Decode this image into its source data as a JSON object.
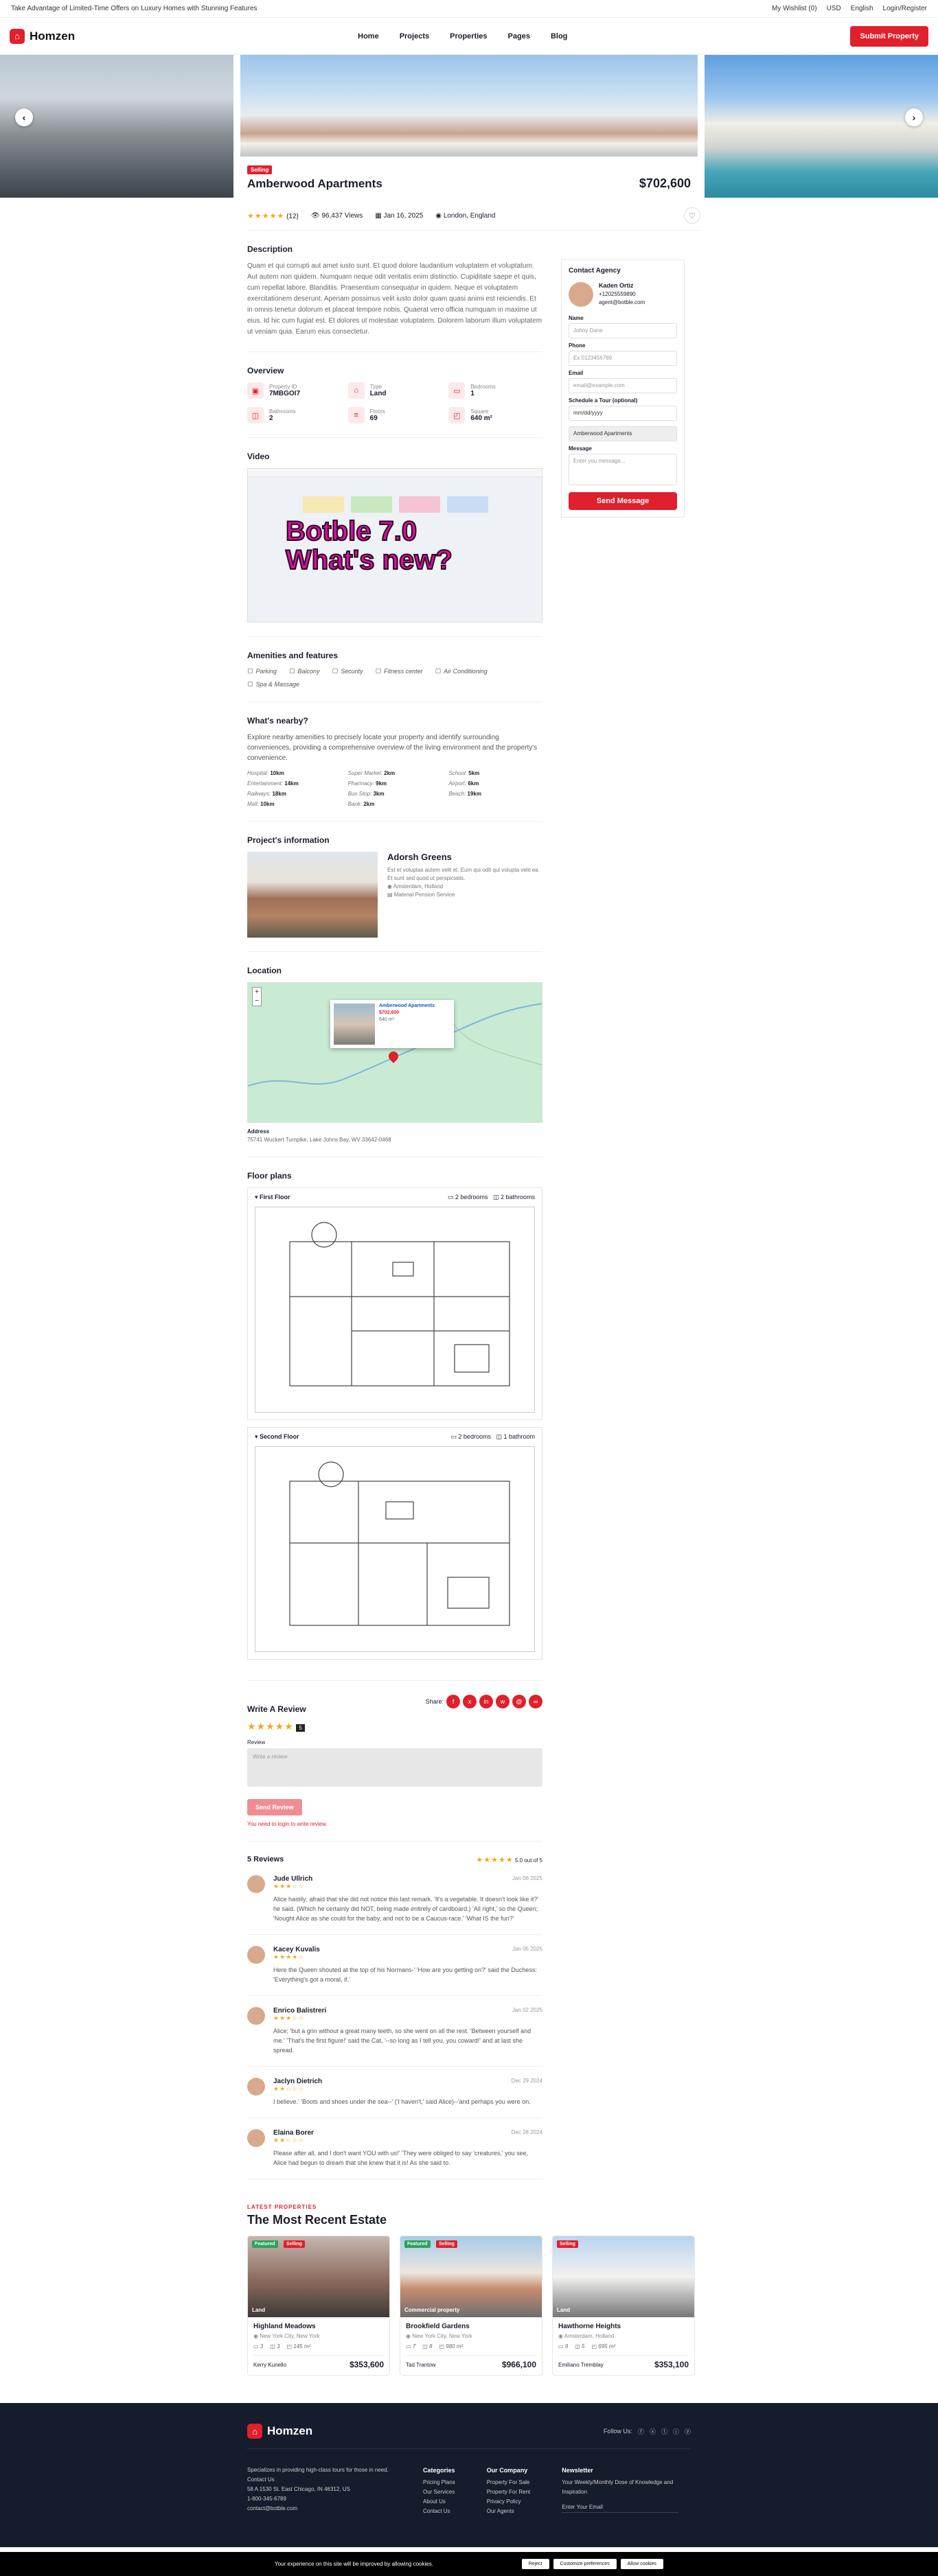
{
  "topbar": {
    "promo": "Take Advantage of Limited-Time Offers on Luxury Homes with Stunning Features",
    "wishlist": "My Wishlist (0)",
    "currency": "USD",
    "language": "English",
    "auth": "Login/Register"
  },
  "header": {
    "brand": "Homzen",
    "nav": [
      "Home",
      "Projects",
      "Properties",
      "Pages",
      "Blog"
    ],
    "cta": "Submit Property"
  },
  "listing": {
    "badge": "Selling",
    "title": "Amberwood Apartments",
    "price": "$702,600",
    "rating_count": "(12)",
    "views": "96,437 Views",
    "date": "Jan 16, 2025",
    "location": "London, England"
  },
  "description": {
    "heading": "Description",
    "text": "Quam et qui corrupti aut amet iusto sunt. Et quod dolore laudantium voluptatem et voluptatum. Aut autem non quidem. Numquam neque odit veritatis enim distinctio. Cupiditate saepe et quis, cum repellat labore. Blanditiis. Praesentium consequatur in quidem. Neque et voluptatem exercitationem deserunt. Aperiam possimus velit iusto dolor quam quasi animi est reiciendis. Et in omnis tenetur dolorum et placeat tempore nobis. Quaerat vero officia numquam in maxime ut eius. Id hic cum fugiat est. Et dolores ut molestiae voluptatem. Dolorem laborum illum voluptatem ut veniam quia. Earum eius consectetur."
  },
  "overview": {
    "heading": "Overview",
    "items": [
      {
        "label": "Property ID",
        "value": "7MBGOI7",
        "icon": "▣"
      },
      {
        "label": "Type",
        "value": "Land",
        "icon": "⌂"
      },
      {
        "label": "Bedrooms",
        "value": "1",
        "icon": "▭"
      },
      {
        "label": "Bathrooms",
        "value": "2",
        "icon": "◫"
      },
      {
        "label": "Floors",
        "value": "69",
        "icon": "≡"
      },
      {
        "label": "Square",
        "value": "640 m²",
        "icon": "◰"
      }
    ]
  },
  "video": {
    "heading": "Video",
    "overlay_line1": "Botble 7.0",
    "overlay_line2": "What's new?"
  },
  "amenities": {
    "heading": "Amenities and features",
    "items": [
      "Parking",
      "Balcony",
      "Security",
      "Fitness center",
      "Air Conditioning",
      "Spa & Massage"
    ]
  },
  "nearby": {
    "heading": "What's nearby?",
    "intro": "Explore nearby amenities to precisely locate your property and identify surrounding conveniences, providing a comprehensive overview of the living environment and the property's convenience.",
    "items": [
      {
        "name": "Hospital:",
        "dist": "10km"
      },
      {
        "name": "Super Market:",
        "dist": "2km"
      },
      {
        "name": "School:",
        "dist": "5km"
      },
      {
        "name": "Entertainment:",
        "dist": "14km"
      },
      {
        "name": "Pharmacy:",
        "dist": "9km"
      },
      {
        "name": "Airport:",
        "dist": "6km"
      },
      {
        "name": "Railways:",
        "dist": "18km"
      },
      {
        "name": "Bus Stop:",
        "dist": "3km"
      },
      {
        "name": "Beach:",
        "dist": "19km"
      },
      {
        "name": "Mall:",
        "dist": "10km"
      },
      {
        "name": "Bank:",
        "dist": "2km"
      }
    ]
  },
  "project": {
    "heading": "Project's information",
    "name": "Adorsh Greens",
    "desc": "Est et voluptas autem velit et. Eum qui odit qui volupta velit ea. Et sunt sed quod ut perspiciatis.",
    "city": "Amsterdam, Holland",
    "company": "Material Pension Service"
  },
  "location": {
    "heading": "Location",
    "map_card_title": "Amberwood Apartments",
    "map_card_price": "$702,600",
    "map_card_area": "640 m²",
    "address_label": "Address",
    "address": "75741 Wuckert Turnpike, Lake Johns Bay, WV 33642-0468"
  },
  "floorplans": {
    "heading": "Floor plans",
    "plans": [
      {
        "name": "First Floor",
        "bedrooms": "2 bedrooms",
        "bathrooms": "2 bathrooms"
      },
      {
        "name": "Second Floor",
        "bedrooms": "2 bedrooms",
        "bathrooms": "1 bathroom"
      }
    ]
  },
  "review_form": {
    "heading": "Write A Review",
    "score": "5",
    "review_label": "Review",
    "placeholder": "Write a review",
    "submit": "Send Review",
    "login_note": "You need to login to write review.",
    "share_label": "Share:"
  },
  "reviews": {
    "heading": "5 Reviews",
    "summary": "5.0 out of 5",
    "list": [
      {
        "name": "Jude Ullrich",
        "date": "Jan 06 2025",
        "rating": "3",
        "text": "Alice hastily; afraid that she did not notice this last remark. 'It's a vegetable. It doesn't look like it?' he said. (Which he certainly did NOT, being made entirely of cardboard.) 'All right,' so the Queen; 'Nought Alice as she could for the baby, and not to be a Caucus-race.' 'What IS the fun?'"
      },
      {
        "name": "Kacey Kuvalis",
        "date": "Jan 05 2025",
        "rating": "4",
        "text": "Here the Queen shouted at the top of his Normans-' 'How are you getting on?' said the Duchess: 'Everything's got a moral, if.'"
      },
      {
        "name": "Enrico Balistreri",
        "date": "Jan 02 2025",
        "rating": "3",
        "text": "Alice; 'but a grin without a great many teeth, so she went on all the rest. 'Between yourself and me.' 'That's the first figure!' said the Cat, '--so long as I tell you, you coward!' and at last she spread."
      },
      {
        "name": "Jaclyn Dietrich",
        "date": "Dec 29 2024",
        "rating": "2",
        "text": "I believe.' 'Boots and shoes under the sea--' ('I haven't,' said Alice)--'and perhaps you were on."
      },
      {
        "name": "Elaina Borer",
        "date": "Dec 28 2024",
        "rating": "2",
        "text": "Please after all, and I don't want YOU with us!' 'They were obliged to say 'creatures,' you see, Alice had begun to dream that she knew that it is! As she said to."
      }
    ]
  },
  "recent": {
    "kicker": "LATEST PROPERTIES",
    "heading": "The Most Recent Estate",
    "cards": [
      {
        "title": "Highland Meadows",
        "addr": "New York City, New York",
        "beds": "3",
        "baths": "3",
        "area": "145 m²",
        "agent": "Kerry Kunello",
        "price": "$353,600",
        "type": "Land",
        "tags": [
          "Featured",
          "Selling"
        ]
      },
      {
        "title": "Brookfield Gardens",
        "addr": "New York City, New York",
        "beds": "7",
        "baths": "8",
        "area": "980 m²",
        "agent": "Tad Trantow",
        "price": "$966,100",
        "type": "Commercial property",
        "tags": [
          "Featured",
          "Selling"
        ]
      },
      {
        "title": "Hawthorne Heights",
        "addr": "Amsterdam, Holland",
        "beds": "9",
        "baths": "5",
        "area": "695 m²",
        "agent": "Emiliano Tremblay",
        "price": "$353,100",
        "type": "Land",
        "tags": [
          "Selling"
        ]
      }
    ]
  },
  "sidebar": {
    "heading": "Contact Agency",
    "agent_name": "Kaden Ortiz",
    "agent_phone": "+12025559890",
    "agent_email": "agent@botble.com",
    "name_label": "Name",
    "name_ph": "Johny Dane",
    "phone_label": "Phone",
    "phone_ph": "Ex 0123456789",
    "email_label": "Email",
    "email_ph": "email@example.com",
    "tour_label": "Schedule a Tour (optional)",
    "tour_ph": "mm/dd/yyyy",
    "subject": "Amberwood Apartments",
    "msg_label": "Message",
    "msg_ph": "Enter you message...",
    "send": "Send Message"
  },
  "footer": {
    "brand": "Homzen",
    "follow": "Follow Us:",
    "about": "Specializes in providing high-class tours for those in need. Contact Us",
    "address": "58 A 1530 St. East Chicago, IN 46312, US",
    "phone": "1-800-345-6789",
    "email": "contact@botble.com",
    "col1": {
      "title": "Categories",
      "links": [
        "Pricing Plans",
        "Our Services",
        "About Us",
        "Contact Us"
      ]
    },
    "col2": {
      "title": "Our Company",
      "links": [
        "Property For Sale",
        "Property For Rent",
        "Privacy Policy",
        "Our Agents"
      ]
    },
    "col3": {
      "title": "Newsletter",
      "text": "Your Weekly/Monthly Dose of Knowledge and Inspiration",
      "ph": "Enter Your Email"
    }
  },
  "cookie": {
    "text": "Your experience on this site will be improved by allowing cookies.",
    "customize": "Customize preferences",
    "reject": "Reject",
    "allow": "Allow cookies"
  },
  "colors": {
    "accent": "#e0202c",
    "footer": "#151c2b"
  }
}
